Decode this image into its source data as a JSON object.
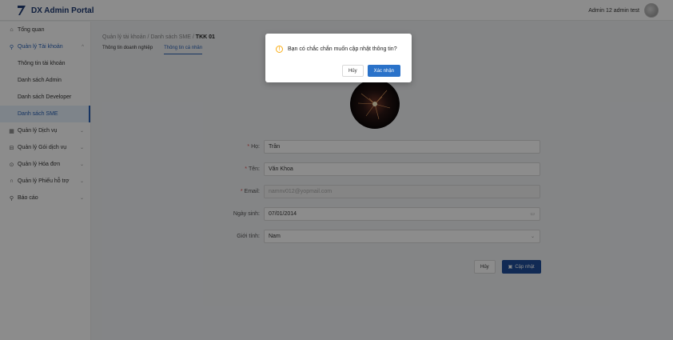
{
  "header": {
    "app_title": "DX Admin Portal",
    "user_name": "Admin 12 admin test"
  },
  "sidebar": {
    "items": [
      {
        "label": "Tổng quan",
        "icon": "home-icon"
      },
      {
        "label": "Quản lý Tài khoản",
        "icon": "user-icon",
        "open": true,
        "children": [
          {
            "label": "Thông tin tài khoản"
          },
          {
            "label": "Danh sách Admin"
          },
          {
            "label": "Danh sách Developer"
          },
          {
            "label": "Danh sách SME",
            "active": true
          }
        ]
      },
      {
        "label": "Quản lý Dịch vụ",
        "icon": "grid-icon"
      },
      {
        "label": "Quản lý Gói dịch vụ",
        "icon": "package-icon"
      },
      {
        "label": "Quản lý Hóa đơn",
        "icon": "invoice-icon"
      },
      {
        "label": "Quản lý Phiếu hỗ trợ",
        "icon": "headset-icon"
      },
      {
        "label": "Báo cáo",
        "icon": "report-icon"
      }
    ]
  },
  "breadcrumb": {
    "level1": "Quản lý tài khoản",
    "level2": "Danh sách SME",
    "current": "TKK 01",
    "separator": "/"
  },
  "tabs": [
    {
      "label": "Thông tin doanh nghiệp",
      "active": false
    },
    {
      "label": "Thông tin cá nhân",
      "active": true
    }
  ],
  "form": {
    "last_name": {
      "label": "Họ:",
      "value": "Trần",
      "required": true
    },
    "first_name": {
      "label": "Tên:",
      "value": "Văn Khoa",
      "required": true
    },
    "email": {
      "label": "Email:",
      "value": "namnv012@yopmail.com",
      "required": true
    },
    "birthday": {
      "label": "Ngày sinh:",
      "value": "07/01/2014"
    },
    "gender": {
      "label": "Giới tính:",
      "value": "Nam"
    },
    "cancel_label": "Hủy",
    "update_label": "Cập nhật"
  },
  "modal": {
    "message": "Bạn có chắc chắn muốn cập nhật thông tin?",
    "cancel_label": "Hủy",
    "confirm_label": "Xác nhận"
  },
  "colors": {
    "primary": "#1f4e9a",
    "modal_confirm": "#2a72c9",
    "warning": "#faad14",
    "required": "#e14b4b"
  }
}
